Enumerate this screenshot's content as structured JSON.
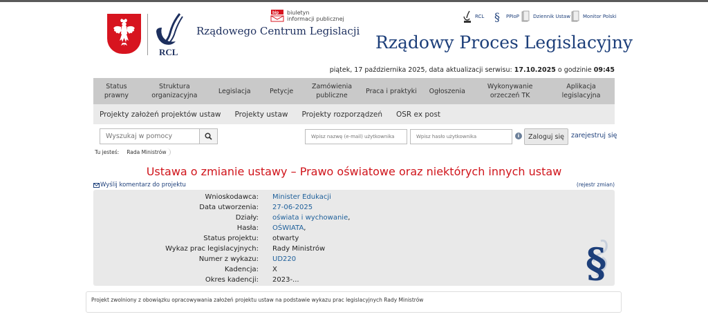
{
  "header": {
    "rcl_name": "Rządowego Centrum Legislacji",
    "rcl_abbr": "RCL",
    "bip_badge": "bip",
    "bip_line1": "biuletyn",
    "bip_line2": "informacji publicznej",
    "site_title": "Rządowy Proces Legislacyjny"
  },
  "quick_links": [
    {
      "label": "RCL",
      "icon": "rcl-icon"
    },
    {
      "label": "PPIoP",
      "icon": "ppiop-icon"
    },
    {
      "label": "Dziennik Ustaw",
      "icon": "dziennik-ustaw-icon"
    },
    {
      "label": "Monitor Polski",
      "icon": "monitor-polski-icon"
    }
  ],
  "date_line": {
    "prefix": "piątek, 17 października 2025, data aktualizacji serwisu: ",
    "update_date": "17.10.2025",
    "middle": " o godzinie ",
    "update_time": "09:45"
  },
  "main_nav": [
    {
      "label": "Status prawny"
    },
    {
      "label": "Struktura organizacyjna"
    },
    {
      "label": "Legislacja"
    },
    {
      "label": "Petycje"
    },
    {
      "label": "Zamówienia publiczne"
    },
    {
      "label": "Praca i praktyki"
    },
    {
      "label": "Ogłoszenia"
    },
    {
      "label": "Wykonywanie orzeczeń TK"
    },
    {
      "label": "Aplikacja legislacyjna"
    }
  ],
  "sub_nav": [
    {
      "label": "Projekty założeń projektów ustaw"
    },
    {
      "label": "Projekty ustaw"
    },
    {
      "label": "Projekty rozporządzeń"
    },
    {
      "label": "OSR ex post"
    }
  ],
  "search": {
    "placeholder": "Wyszukaj w pomocy",
    "value": ""
  },
  "login": {
    "email_placeholder": "Wpisz nazwę (e-mail) użytkownika",
    "password_placeholder": "Wpisz hasło użytkownika",
    "info": "i",
    "button": "Zaloguj się",
    "register": "zarejestruj się"
  },
  "breadcrumb": {
    "prefix": "Tu jesteś:",
    "current": "Rada Ministrów"
  },
  "project": {
    "title": "Ustawa o zmianie ustawy – Prawo oświatowe oraz niektórych innych ustaw",
    "comment_link": "Wyślij komentarz do projektu",
    "changelog_link": "(rejestr zmian)",
    "fields": [
      {
        "label": "Wnioskodawca:",
        "value": "Minister Edukacji",
        "link": true
      },
      {
        "label": "Data utworzenia:",
        "value": "27-06-2025",
        "link": true
      },
      {
        "label": "Działy:",
        "value": "oświata i wychowanie",
        "suffix": ",",
        "link": true
      },
      {
        "label": "Hasła:",
        "value": "OŚWIATA",
        "suffix": ",",
        "link": true
      },
      {
        "label": "Status projektu:",
        "value": "otwarty",
        "link": false
      },
      {
        "label": "Wykaz prac legislacyjnych:",
        "value": "Rady Ministrów",
        "link": false
      },
      {
        "label": "Numer z wykazu:",
        "value": "UD220",
        "link": true
      },
      {
        "label": "Kadencja:",
        "value": "X",
        "link": false
      },
      {
        "label": "Okres kadencji:",
        "value": "2023-...",
        "link": false
      }
    ],
    "note": "Projekt zwolniony z obowiązku opracowywania założeń projektu ustaw na podstawie wykazu prac legislacyjnych Rady Ministrów"
  },
  "colors": {
    "accent_navy": "#1d3f7a",
    "heading_red": "#d0141b",
    "emblem_red": "#d7141f",
    "nav_gray": "#c9c9c9",
    "subnav_gray": "#eaeaea",
    "details_bg": "#e9e9e9"
  }
}
